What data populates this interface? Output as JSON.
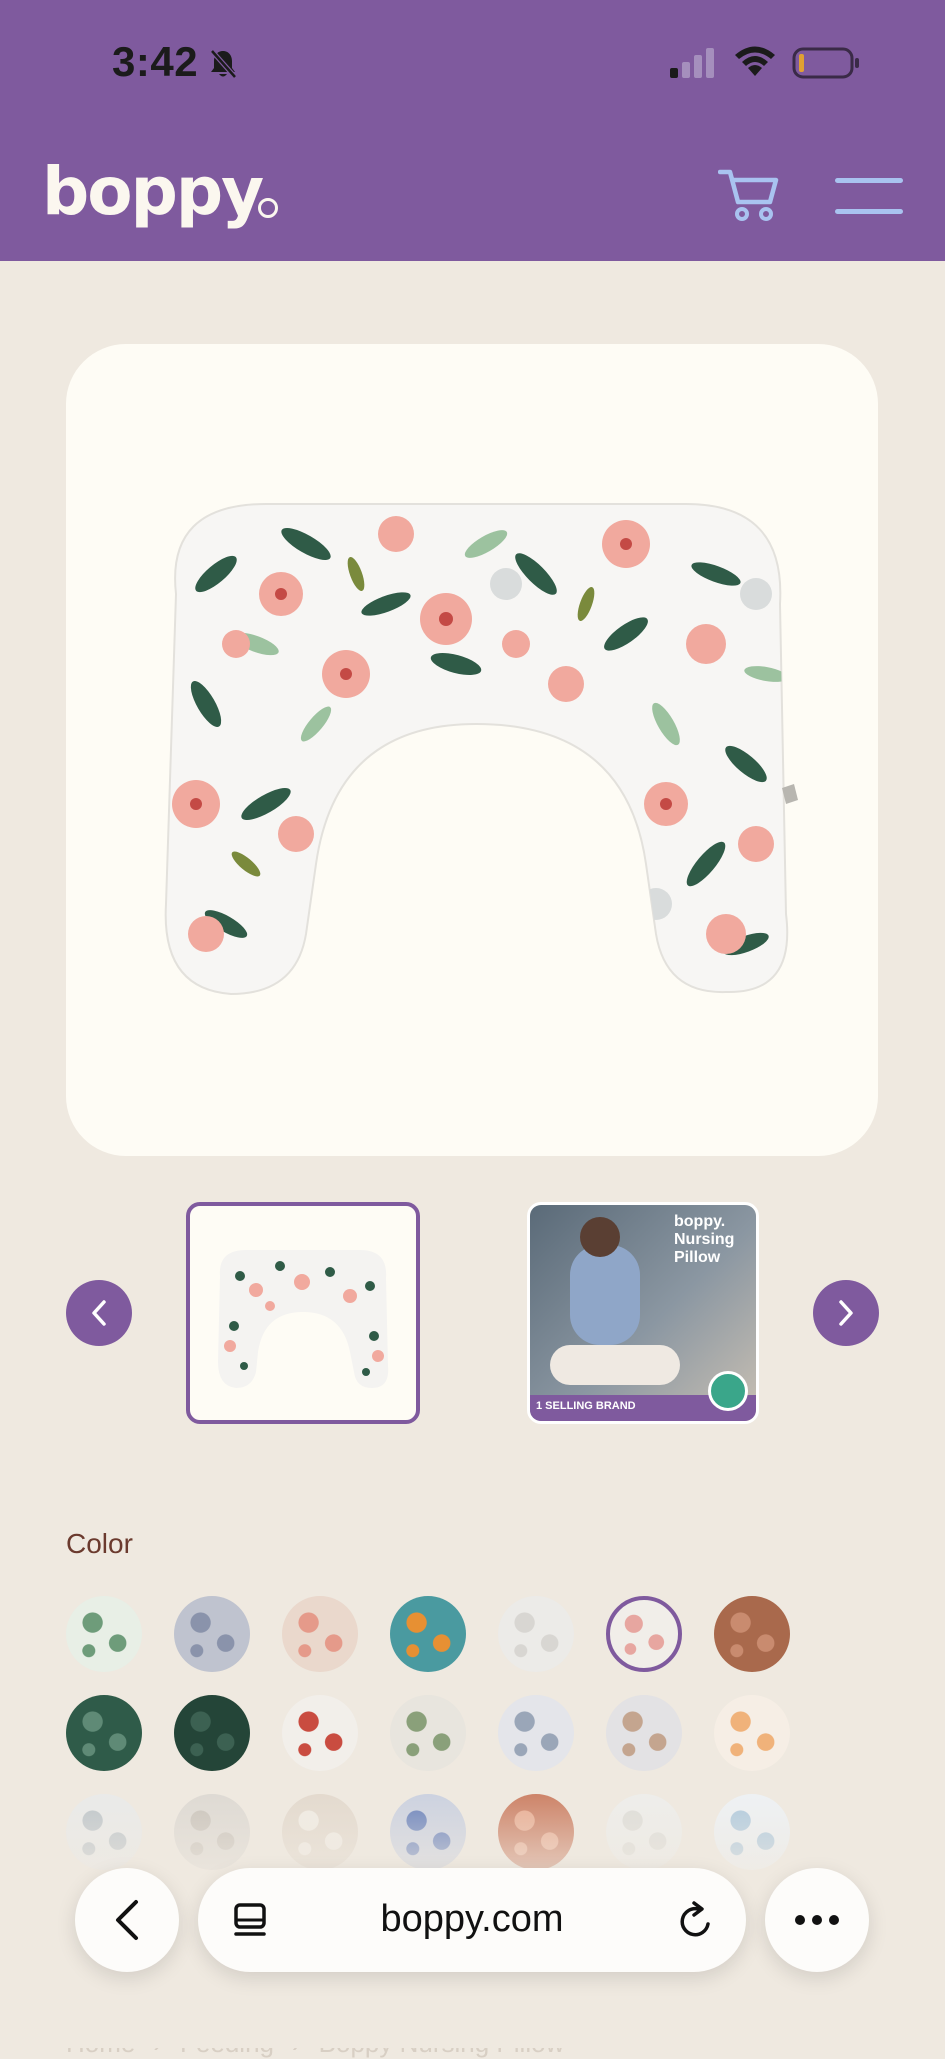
{
  "status_bar": {
    "time": "3:42"
  },
  "header": {
    "logo": "boppy"
  },
  "product": {
    "thumbnail_overlay_brand": "boppy.",
    "thumbnail_overlay_title": "Nursing Pillow",
    "thumbnail_badge": "1 SELLING BRAND"
  },
  "color": {
    "label": "Color",
    "swatches": [
      {
        "color": "#e8efe6",
        "accent": "#6e9c7a"
      },
      {
        "color": "#bfc3cf",
        "accent": "#8a93ab"
      },
      {
        "color": "#ead8cc",
        "accent": "#e59a8a"
      },
      {
        "color": "#4a9aa0",
        "accent": "#e79033"
      },
      {
        "color": "#ecebe8",
        "accent": "#d8d6d2"
      },
      {
        "color": "#f1eee9",
        "accent": "#e7a6a0",
        "selected": true
      },
      {
        "color": "#a9694c",
        "accent": "#c98b6f"
      },
      {
        "color": "#2f5b49",
        "accent": "#5f8a76"
      },
      {
        "color": "#244538",
        "accent": "#3c6152"
      },
      {
        "color": "#f2efea",
        "accent": "#c94c40"
      },
      {
        "color": "#e8e5de",
        "accent": "#8aa07a"
      },
      {
        "color": "#e4e5ea",
        "accent": "#9aa6b8"
      },
      {
        "color": "#e3e2e4",
        "accent": "#c4a58f"
      },
      {
        "color": "#f6eee5",
        "accent": "#f0b27a"
      },
      {
        "color": "#e9eaea",
        "accent": "#b9c2c8"
      },
      {
        "color": "#dcd8d2",
        "accent": "#c6c0b8"
      },
      {
        "color": "#e2d8cc",
        "accent": "#f1ece4"
      },
      {
        "color": "#c8cfe0",
        "accent": "#5d78b8"
      },
      {
        "color": "#c9775a",
        "accent": "#e8a68a"
      },
      {
        "color": "#eeeeec",
        "accent": "#dcdcd8"
      },
      {
        "color": "#eef2f6",
        "accent": "#a9c7de"
      }
    ]
  },
  "breadcrumb": [
    "Home",
    "›",
    "Feeding",
    "›",
    "Boppy Nursing Pillow"
  ],
  "browser": {
    "url": "boppy.com"
  }
}
